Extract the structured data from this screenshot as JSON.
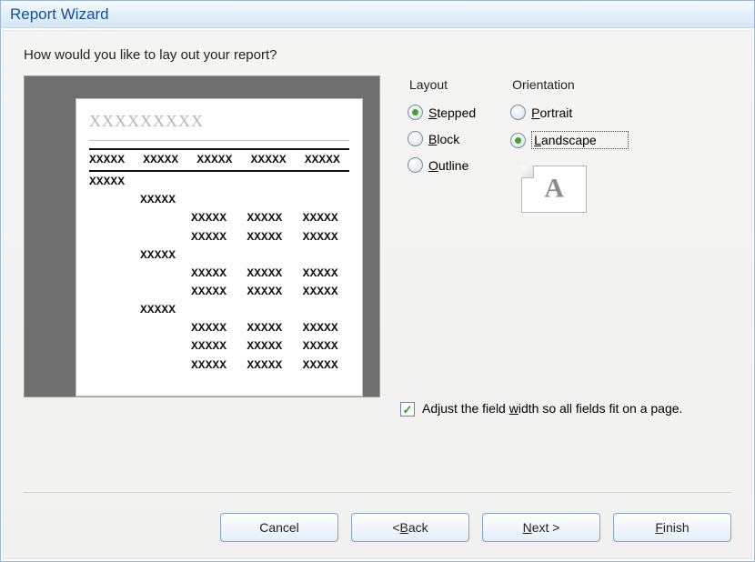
{
  "title": "Report Wizard",
  "question": "How would you like to lay out your report?",
  "preview": {
    "heading": "XXXXXXXXX",
    "cell": "XXXXX"
  },
  "layout": {
    "label": "Layout",
    "options": [
      {
        "pre": "",
        "ul": "S",
        "post": "tepped",
        "selected": true
      },
      {
        "pre": "",
        "ul": "B",
        "post": "lock",
        "selected": false
      },
      {
        "pre": "",
        "ul": "O",
        "post": "utline",
        "selected": false
      }
    ]
  },
  "orientation": {
    "label": "Orientation",
    "options": [
      {
        "pre": "",
        "ul": "P",
        "post": "ortrait",
        "selected": false
      },
      {
        "pre": "",
        "ul": "L",
        "post": "andscape",
        "selected": true,
        "focused": true
      }
    ],
    "icon_letter": "A"
  },
  "adjust_width": {
    "checked": true,
    "pre": "Adjust the field ",
    "ul": "w",
    "post": "idth so all fields fit on a page."
  },
  "buttons": {
    "cancel": {
      "pre": "Cancel",
      "ul": "",
      "post": ""
    },
    "back": {
      "pre": "< ",
      "ul": "B",
      "post": "ack"
    },
    "next": {
      "pre": "",
      "ul": "N",
      "post": "ext >"
    },
    "finish": {
      "pre": "",
      "ul": "F",
      "post": "inish"
    }
  }
}
